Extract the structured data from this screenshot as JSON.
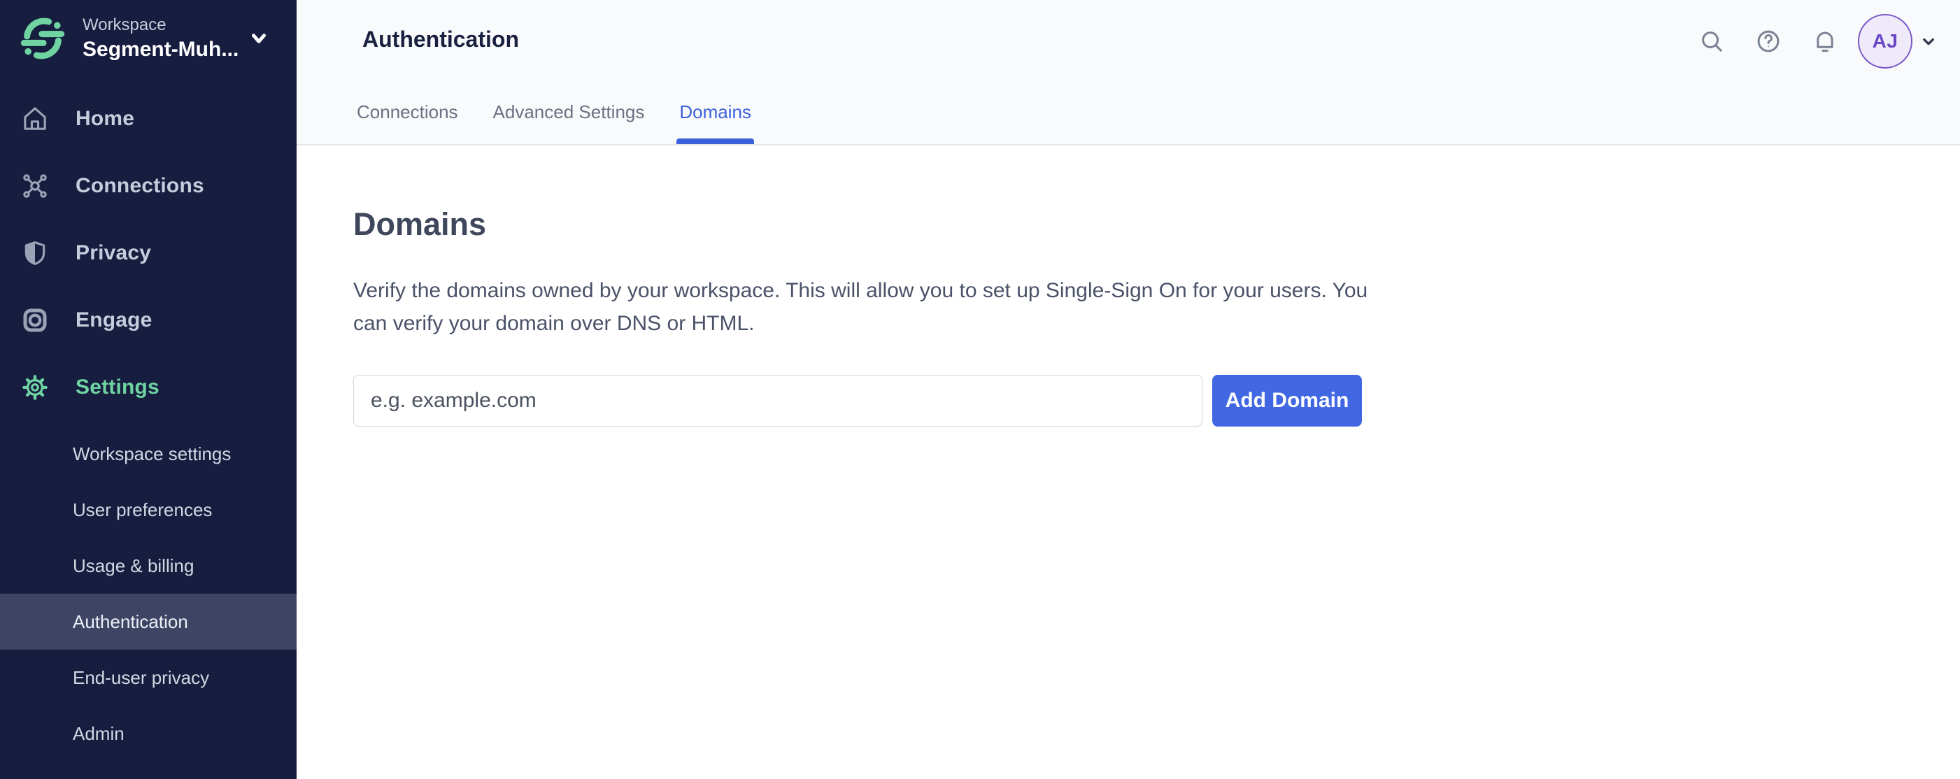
{
  "workspace": {
    "label": "Workspace",
    "name": "Segment-Muh..."
  },
  "sidebar": {
    "items": [
      {
        "label": "Home",
        "icon": "home-icon"
      },
      {
        "label": "Connections",
        "icon": "connections-icon"
      },
      {
        "label": "Privacy",
        "icon": "shield-icon"
      },
      {
        "label": "Engage",
        "icon": "engage-icon"
      },
      {
        "label": "Settings",
        "icon": "gear-icon",
        "active": true
      }
    ],
    "settings_children": [
      {
        "label": "Workspace settings"
      },
      {
        "label": "User preferences"
      },
      {
        "label": "Usage & billing"
      },
      {
        "label": "Authentication",
        "active": true
      },
      {
        "label": "End-user privacy"
      },
      {
        "label": "Admin"
      }
    ]
  },
  "header": {
    "title": "Authentication",
    "tabs": [
      {
        "label": "Connections"
      },
      {
        "label": "Advanced Settings"
      },
      {
        "label": "Domains",
        "active": true
      }
    ],
    "topbar_icons": [
      "search-icon",
      "help-icon",
      "bell-icon"
    ],
    "avatar_initials": "AJ"
  },
  "main": {
    "heading": "Domains",
    "description_line1": "Verify the domains owned by your workspace. This will allow you to set up Single-Sign On for your users. You",
    "description_line2": "can verify your domain over DNS or HTML.",
    "form": {
      "input_value": "",
      "input_placeholder": "e.g. example.com",
      "button_label": "Add Domain"
    }
  },
  "colors": {
    "sidebar_bg": "#161D3E",
    "sidebar_highlight": "#3E4564",
    "accent_green": "#70D3A2",
    "tab_active_blue": "#3D61DB",
    "button_blue": "#4167E2",
    "avatar_purple": "#7A58C9",
    "header_bg": "#F9FAFB"
  }
}
